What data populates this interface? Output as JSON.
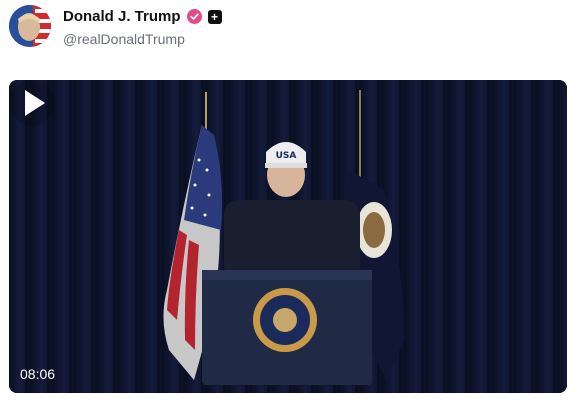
{
  "post": {
    "author_name": "Donald J. Trump",
    "author_handle": "@realDonaldTrump",
    "badges": [
      "verified-badge-icon",
      "plus-badge-icon"
    ],
    "plus_symbol": "+"
  },
  "video": {
    "duration": "08:06",
    "cap_text": "USA",
    "icon": "play-icon"
  },
  "colors": {
    "verified": "#e24c8a",
    "video_bg": "#0b1024",
    "handle": "#6b6f76"
  }
}
